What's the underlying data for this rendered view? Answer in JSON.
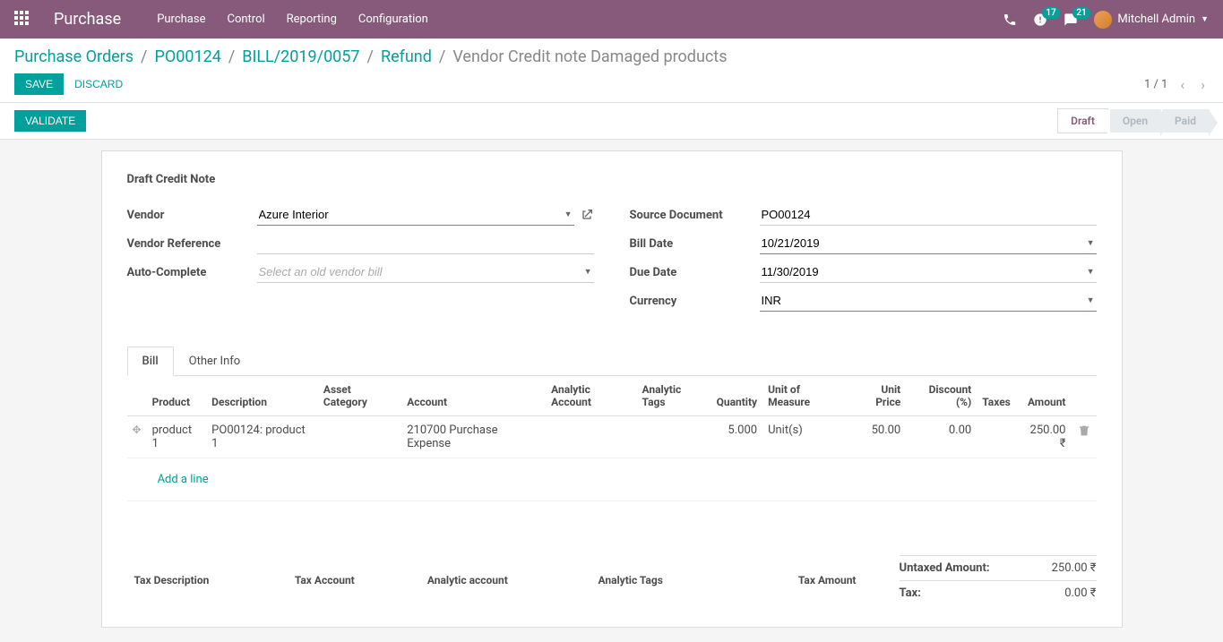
{
  "topbar": {
    "app_title": "Purchase",
    "menu": [
      "Purchase",
      "Control",
      "Reporting",
      "Configuration"
    ],
    "activities_badge": "17",
    "messages_badge": "21",
    "user_name": "Mitchell Admin"
  },
  "breadcrumbs": {
    "items": [
      "Purchase Orders",
      "PO00124",
      "BILL/2019/0057",
      "Refund"
    ],
    "current": "Vendor Credit note Damaged products"
  },
  "buttons": {
    "save": "Save",
    "discard": "Discard",
    "validate": "Validate"
  },
  "pager": {
    "text": "1 / 1"
  },
  "status": {
    "steps": [
      "Draft",
      "Open",
      "Paid"
    ],
    "active_index": 0
  },
  "sheet": {
    "title": "Draft Credit Note",
    "labels": {
      "vendor": "Vendor",
      "vendor_reference": "Vendor Reference",
      "auto_complete": "Auto-Complete",
      "source_document": "Source Document",
      "bill_date": "Bill Date",
      "due_date": "Due Date",
      "currency": "Currency"
    },
    "values": {
      "vendor": "Azure Interior",
      "vendor_reference": "",
      "auto_complete_placeholder": "Select an old vendor bill",
      "source_document": "PO00124",
      "bill_date": "10/21/2019",
      "due_date": "11/30/2019",
      "currency": "INR"
    }
  },
  "tabs": {
    "bill": "Bill",
    "other": "Other Info"
  },
  "lines": {
    "headers": {
      "product": "Product",
      "description": "Description",
      "asset_category": "Asset Category",
      "account": "Account",
      "analytic_account": "Analytic Account",
      "analytic_tags": "Analytic Tags",
      "quantity": "Quantity",
      "uom": "Unit of Measure",
      "unit_price": "Unit Price",
      "discount": "Discount (%)",
      "taxes": "Taxes",
      "amount": "Amount"
    },
    "rows": [
      {
        "product": "product 1",
        "description": "PO00124: product 1",
        "asset_category": "",
        "account": "210700 Purchase Expense",
        "analytic_account": "",
        "analytic_tags": "",
        "quantity": "5.000",
        "uom": "Unit(s)",
        "unit_price": "50.00",
        "discount": "0.00",
        "taxes": "",
        "amount": "250.00 ₹"
      }
    ],
    "add_line": "Add a line"
  },
  "tax_headers": {
    "description": "Tax Description",
    "account": "Tax Account",
    "analytic_account": "Analytic account",
    "analytic_tags": "Analytic Tags",
    "amount": "Tax Amount"
  },
  "summary": {
    "untaxed_label": "Untaxed Amount:",
    "untaxed_value": "250.00 ₹",
    "tax_label": "Tax:",
    "tax_value": "0.00 ₹"
  }
}
